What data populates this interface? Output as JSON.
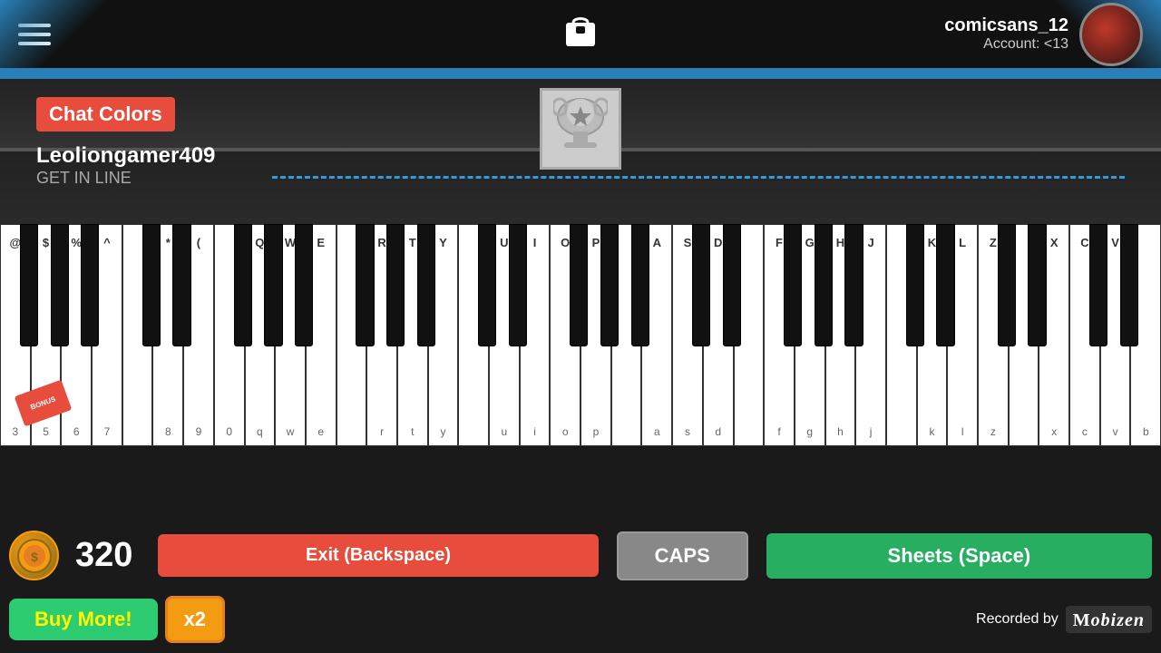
{
  "topbar": {
    "username": "comicsans_12",
    "account_label": "Account: <13"
  },
  "game": {
    "chat_colors_label": "Chat Colors",
    "player_name": "Leoliongamer409",
    "player_status": "GET IN LINE"
  },
  "piano": {
    "white_keys": [
      {
        "top": "@",
        "bottom": "3"
      },
      {
        "top": "$",
        "bottom": "5"
      },
      {
        "top": "%",
        "bottom": "6"
      },
      {
        "top": "^",
        "bottom": "7"
      },
      {
        "top": "",
        "bottom": ""
      },
      {
        "top": "*",
        "bottom": "8"
      },
      {
        "top": "(",
        "bottom": "9"
      },
      {
        "top": "",
        "bottom": "0"
      },
      {
        "top": "Q",
        "bottom": "q"
      },
      {
        "top": "W",
        "bottom": "w"
      },
      {
        "top": "E",
        "bottom": "e"
      },
      {
        "top": "",
        "bottom": ""
      },
      {
        "top": "R",
        "bottom": "r"
      },
      {
        "top": "T",
        "bottom": "t"
      },
      {
        "top": "Y",
        "bottom": "y"
      },
      {
        "top": "",
        "bottom": ""
      },
      {
        "top": "U",
        "bottom": "u"
      },
      {
        "top": "I",
        "bottom": "i"
      },
      {
        "top": "O",
        "bottom": "o"
      },
      {
        "top": "P",
        "bottom": "p"
      },
      {
        "top": "",
        "bottom": ""
      },
      {
        "top": "A",
        "bottom": "a"
      },
      {
        "top": "S",
        "bottom": "s"
      },
      {
        "top": "D",
        "bottom": "d"
      },
      {
        "top": "",
        "bottom": ""
      },
      {
        "top": "F",
        "bottom": "f"
      },
      {
        "top": "G",
        "bottom": "g"
      },
      {
        "top": "H",
        "bottom": "h"
      },
      {
        "top": "J",
        "bottom": "j"
      },
      {
        "top": "",
        "bottom": ""
      },
      {
        "top": "K",
        "bottom": "k"
      },
      {
        "top": "L",
        "bottom": "l"
      },
      {
        "top": "Z",
        "bottom": "z"
      },
      {
        "top": "",
        "bottom": ""
      },
      {
        "top": "X",
        "bottom": "x"
      },
      {
        "top": "C",
        "bottom": "c"
      },
      {
        "top": "V",
        "bottom": "v"
      },
      {
        "top": "",
        "bottom": "b"
      }
    ]
  },
  "controls": {
    "score": "320",
    "exit_label": "Exit (Backspace)",
    "caps_label": "CAPS",
    "sheets_label": "Sheets (Space)",
    "buy_more_label": "Buy More!",
    "x2_label": "x2",
    "recorded_label": "Recorded by",
    "mobizen_label": "Mobizen"
  }
}
